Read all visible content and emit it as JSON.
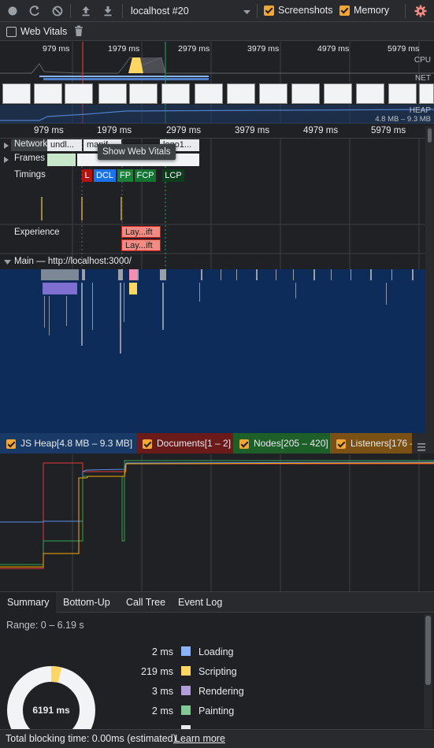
{
  "toolbar": {
    "record_icon": "record-icon",
    "reload_icon": "reload-icon",
    "clear_icon": "clear-icon",
    "upload_icon": "upload-icon",
    "download_icon": "download-icon",
    "recording_select": "localhost #20",
    "screenshots_label": "Screenshots",
    "screenshots_checked": true,
    "memory_label": "Memory",
    "memory_checked": true,
    "settings_icon": "gear-icon"
  },
  "toolbar2": {
    "web_vitals_label": "Web Vitals",
    "web_vitals_checked": false,
    "trash_icon": "trash-icon"
  },
  "overview": {
    "ticks": [
      "979 ms",
      "1979 ms",
      "2979 ms",
      "3979 ms",
      "4979 ms",
      "5979 ms"
    ],
    "cpu_label": "CPU",
    "net_label": "NET",
    "heap_label": "HEAP",
    "heap_range": "4.8 MB – 9.3 MB"
  },
  "timeline": {
    "ticks": [
      "979 ms",
      "1979 ms",
      "2979 ms",
      "3979 ms",
      "4979 ms",
      "5979 ms"
    ],
    "network_label": "Network",
    "network_items": [
      "undl...",
      "manif...",
      "logo1..."
    ],
    "tooltip": "Show Web Vitals",
    "frames_label": "Frames",
    "timings_label": "Timings",
    "timings": [
      "L",
      "DCL",
      "FP",
      "FCP",
      "LCP"
    ],
    "experience_label": "Experience",
    "experience_items": [
      "Lay...ift",
      "Lay...ift"
    ],
    "main_label": "Main — http://localhost:3000/"
  },
  "memory": {
    "legend": [
      {
        "label": "JS Heap[4.8 MB – 9.3 MB]",
        "color": "#1a4a8a"
      },
      {
        "label": "Documents[1 – 2]",
        "color": "#7a1a1a"
      },
      {
        "label": "Nodes[205 – 420]",
        "color": "#1e6b2a"
      },
      {
        "label": "Listeners[176 –",
        "color": "#8a5a14"
      }
    ],
    "menu_icon": "menu-icon"
  },
  "bottom": {
    "tabs": [
      "Summary",
      "Bottom-Up",
      "Call Tree",
      "Event Log"
    ],
    "active_tab": "Summary",
    "range": "Range: 0 – 6.19 s",
    "rows": [
      {
        "value": "2 ms",
        "label": "Loading",
        "color": "#8ab4f8"
      },
      {
        "value": "219 ms",
        "label": "Scripting",
        "color": "#fdd663"
      },
      {
        "value": "3 ms",
        "label": "Rendering",
        "color": "#b39ddb"
      },
      {
        "value": "2 ms",
        "label": "Painting",
        "color": "#81c995"
      }
    ],
    "total_in_chart": "6191 ms",
    "footer_text": "Total blocking time: 0.00ms (estimated)",
    "footer_link": "Learn more"
  }
}
